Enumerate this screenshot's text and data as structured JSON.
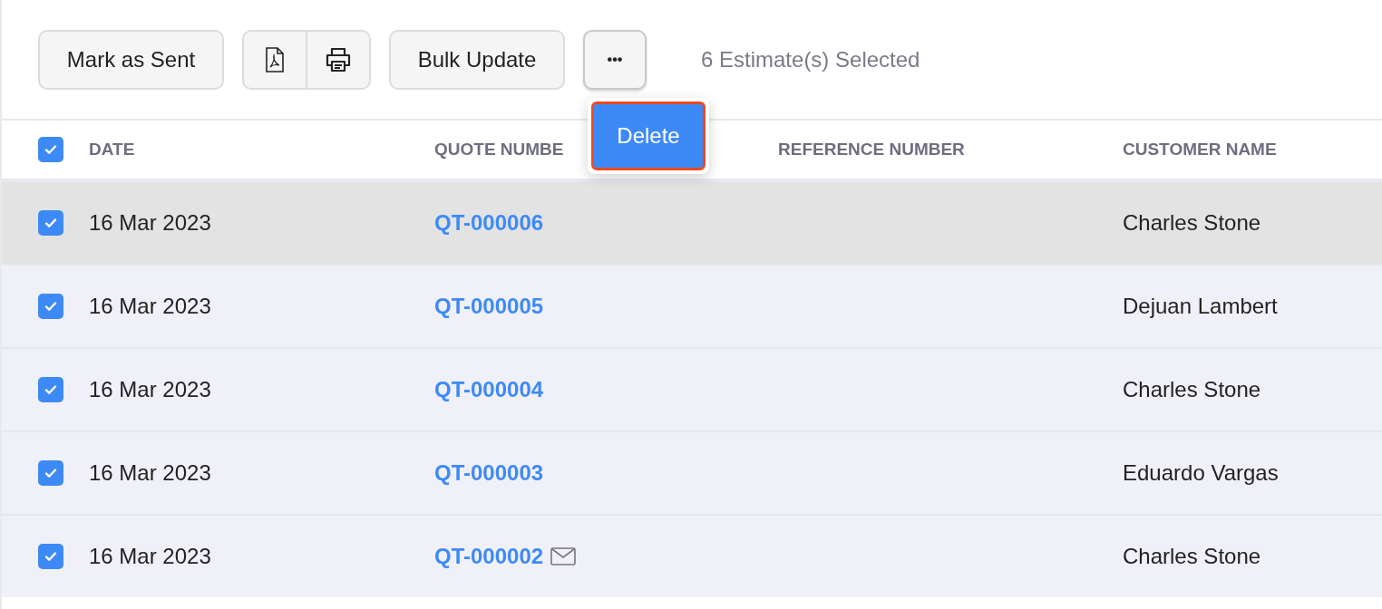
{
  "toolbar": {
    "mark_sent": "Mark as Sent",
    "bulk_update": "Bulk Update",
    "more": "•••",
    "selection_count": "6 Estimate(s) Selected"
  },
  "menu": {
    "items": [
      "Delete"
    ]
  },
  "table": {
    "all_checked": true,
    "columns": [
      "DATE",
      "QUOTE NUMBE",
      "REFERENCE NUMBER",
      "CUSTOMER NAME"
    ],
    "rows": [
      {
        "checked": true,
        "hovered": true,
        "date": "16 Mar 2023",
        "quote": "QT-000006",
        "emailed": false,
        "customer": "Charles Stone"
      },
      {
        "checked": true,
        "hovered": false,
        "date": "16 Mar 2023",
        "quote": "QT-000005",
        "emailed": false,
        "customer": "Dejuan Lambert"
      },
      {
        "checked": true,
        "hovered": false,
        "date": "16 Mar 2023",
        "quote": "QT-000004",
        "emailed": false,
        "customer": "Charles Stone"
      },
      {
        "checked": true,
        "hovered": false,
        "date": "16 Mar 2023",
        "quote": "QT-000003",
        "emailed": false,
        "customer": "Eduardo Vargas"
      },
      {
        "checked": true,
        "hovered": false,
        "date": "16 Mar 2023",
        "quote": "QT-000002",
        "emailed": true,
        "customer": "Charles Stone"
      }
    ]
  }
}
